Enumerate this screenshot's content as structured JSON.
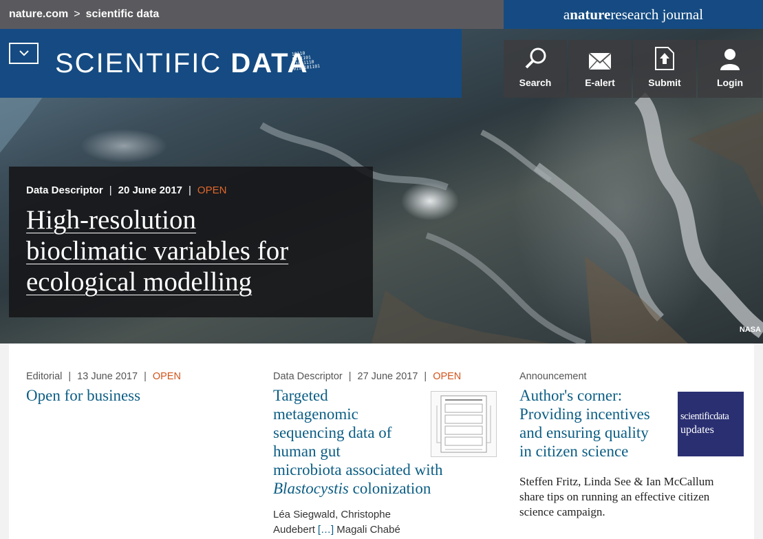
{
  "topbar": {
    "breadcrumb": [
      "nature.com",
      "scientific data"
    ],
    "separator": ">",
    "journal_prefix": "a ",
    "journal_brand_bold": "nature",
    "journal_brand_light": "research",
    "journal_suffix": " journal"
  },
  "brand": {
    "logo_light": "SCIENTIFIC",
    "logo_bold": "DATA",
    "logo_bits": [
      "10110",
      "0111101",
      "11011110",
      "0111101101"
    ]
  },
  "tools": [
    {
      "label": "Search",
      "icon": "search-icon"
    },
    {
      "label": "E-alert",
      "icon": "mail-icon"
    },
    {
      "label": "Submit",
      "icon": "upload-icon"
    },
    {
      "label": "Login",
      "icon": "user-icon"
    }
  ],
  "feature": {
    "type": "Data Descriptor",
    "date": "20 June 2017",
    "status": "OPEN",
    "title_lines": [
      "High-resolution",
      "bioclimatic variables for",
      "ecological modelling"
    ],
    "image_credit": "NASA"
  },
  "articles": [
    {
      "type": "Editorial",
      "date": "13 June 2017",
      "status": "OPEN",
      "title": "Open for business"
    },
    {
      "type": "Data Descriptor",
      "date": "27 June 2017",
      "status": "OPEN",
      "title_lines": [
        "Targeted",
        "metagenomic",
        "sequencing data of",
        "human gut",
        "microbiota associated with"
      ],
      "title_italic": "Blastocystis",
      "title_tail": " colonization",
      "authors_line1": "Léa Siegwald, Christophe",
      "authors_line2a": "Audebert",
      "authors_more": "[…]",
      "authors_line2b": "Magali Chabé"
    },
    {
      "type": "Announcement",
      "title_lines": [
        "Author's corner:",
        "Providing incentives",
        "and ensuring quality",
        "in citizen science"
      ],
      "thumb_line1": "scientificdata",
      "thumb_line2": "updates",
      "desc_lines": [
        "Steffen Fritz, Linda See & Ian McCallum",
        "share tips on running an effective citizen",
        "science campaign."
      ]
    }
  ],
  "colors": {
    "brand_blue": "#154b82",
    "topbar_gray": "#5a5a5e",
    "link_blue": "#0b5d84",
    "open_orange": "#d2541c",
    "updates_navy": "#2a2f72"
  }
}
